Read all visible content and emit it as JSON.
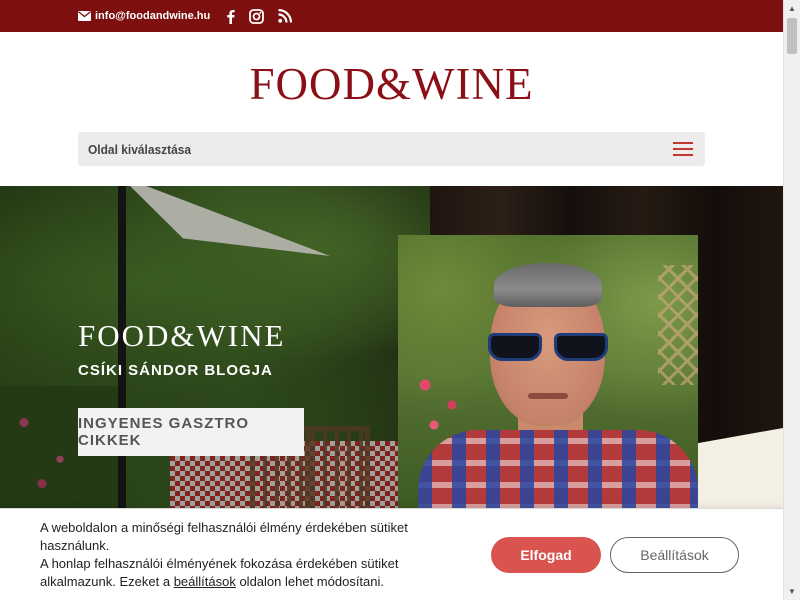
{
  "topbar": {
    "email": "info@foodandwine.hu",
    "social_icons": [
      "facebook-icon",
      "instagram-icon",
      "rss-icon"
    ]
  },
  "header": {
    "logo_text": "FOOD&WINE",
    "nav_select_label": "Oldal kiválasztása"
  },
  "hero": {
    "brand": "FOOD&WINE",
    "subtitle": "CSÍKI SÁNDOR BLOGJA",
    "cta_label": "INGYENES GASZTRO CIKKEK"
  },
  "cookie": {
    "line1": "A weboldalon a minőségi felhasználói élmény érdekében sütiket használunk.",
    "line2_before": "A honlap felhasználói élményének fokozása érdekében sütiket alkalmazunk. Ezeket a ",
    "line2_link": "beállítások",
    "line2_after": " oldalon lehet módosítani.",
    "accept_label": "Elfogad",
    "settings_label": "Beállítások"
  },
  "colors": {
    "brand": "#8b0f16",
    "topbar": "#7d0f0f",
    "accept": "#d9534f"
  }
}
